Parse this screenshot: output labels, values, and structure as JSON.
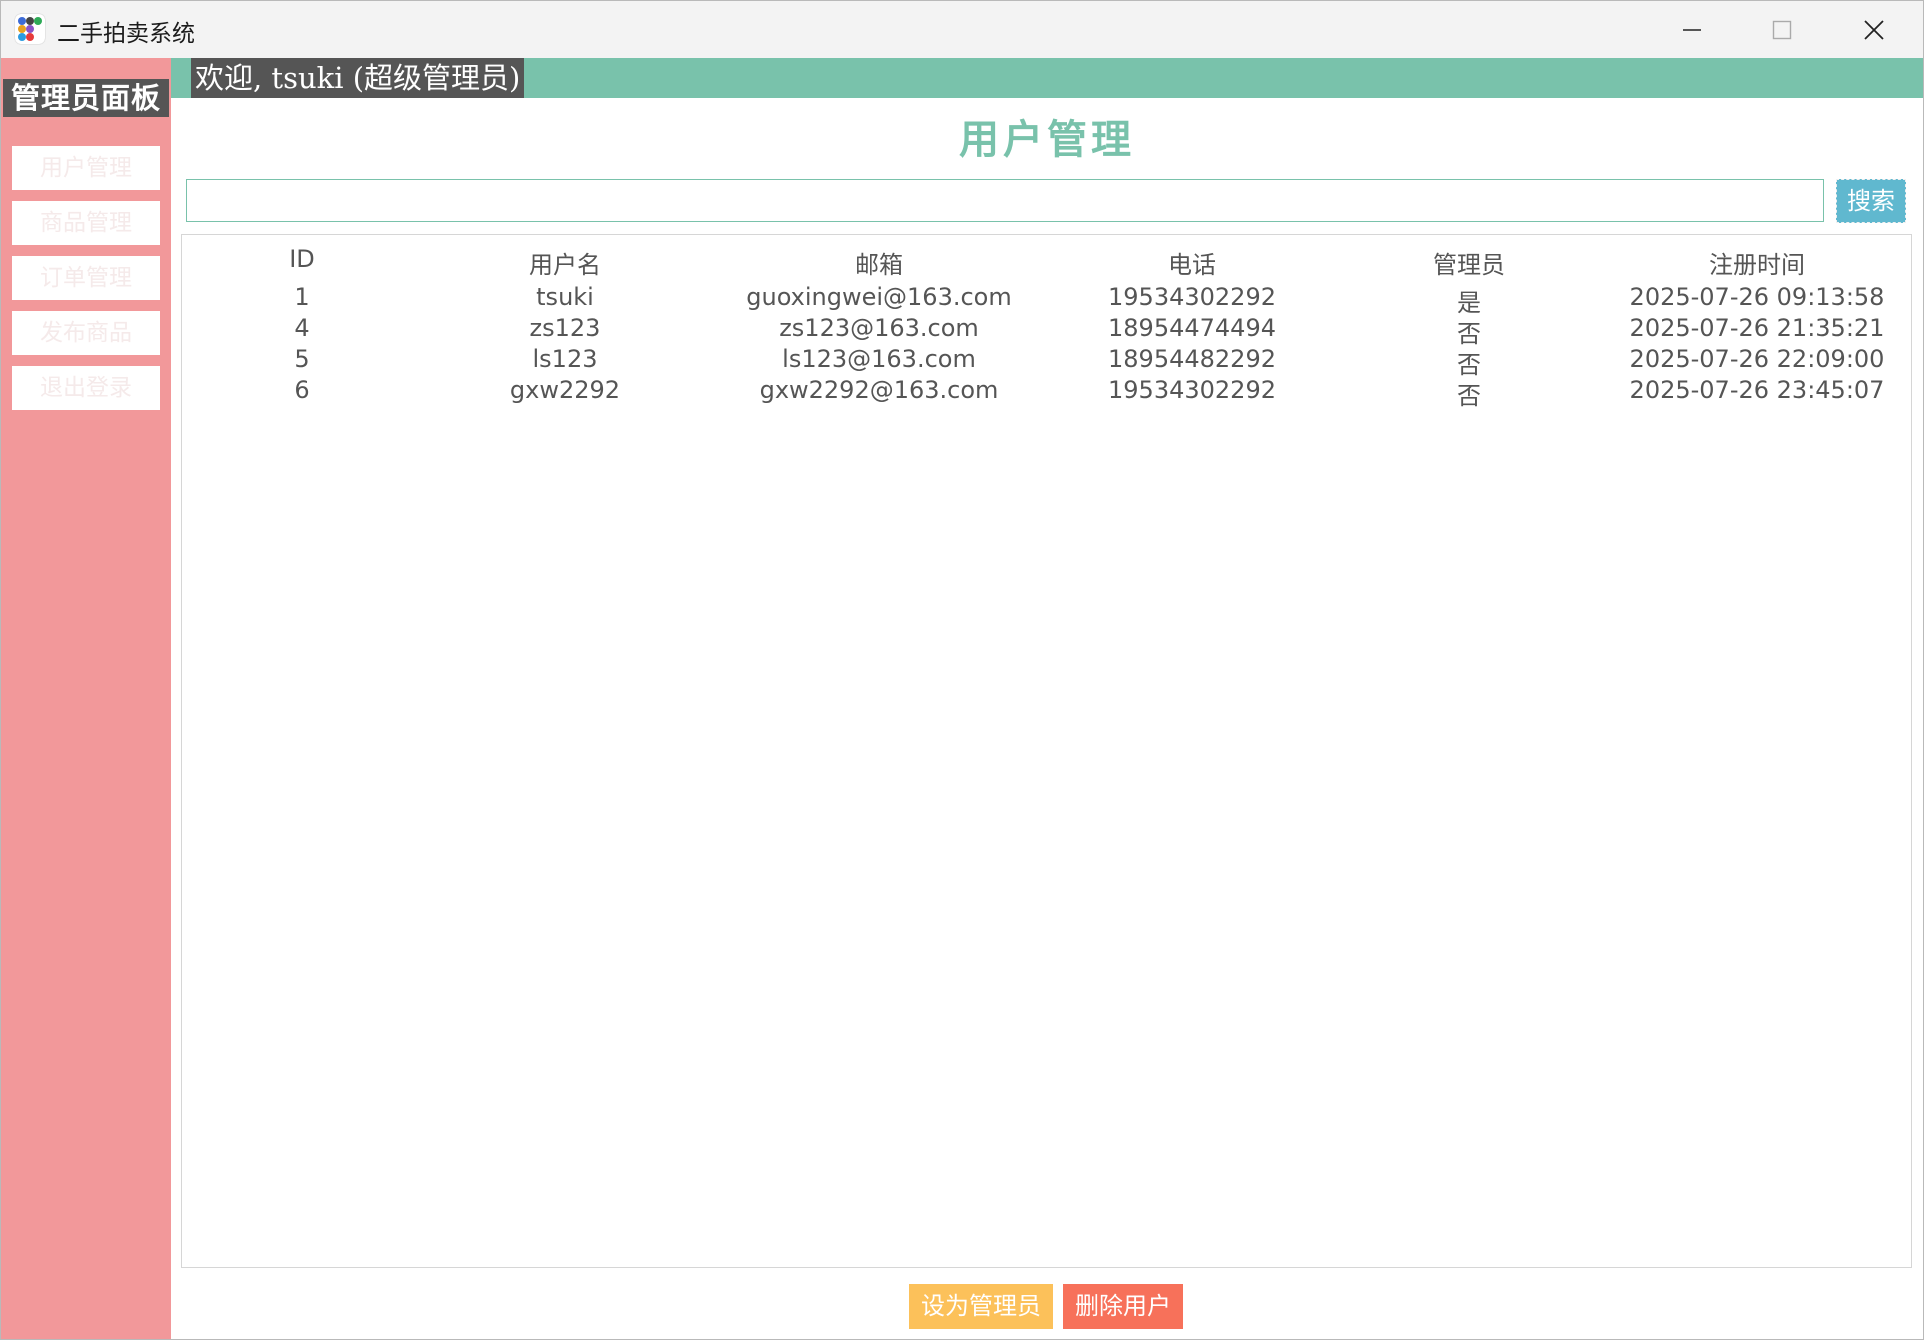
{
  "window": {
    "title": "二手拍卖系统"
  },
  "sidebar": {
    "title": "管理员面板",
    "items": [
      {
        "label": "用户管理"
      },
      {
        "label": "商品管理"
      },
      {
        "label": "订单管理"
      },
      {
        "label": "发布商品"
      },
      {
        "label": "退出登录"
      }
    ]
  },
  "header": {
    "welcome": "欢迎, tsuki (超级管理员)"
  },
  "main": {
    "title": "用户管理",
    "search": {
      "value": "",
      "button": "搜索"
    },
    "table": {
      "columns": [
        "ID",
        "用户名",
        "邮箱",
        "电话",
        "管理员",
        "注册时间"
      ],
      "rows": [
        [
          "1",
          "tsuki",
          "guoxingwei@163.com",
          "19534302292",
          "是",
          "2025-07-26 09:13:58"
        ],
        [
          "4",
          "zs123",
          "zs123@163.com",
          "18954474494",
          "否",
          "2025-07-26 21:35:21"
        ],
        [
          "5",
          "ls123",
          "ls123@163.com",
          "18954482292",
          "否",
          "2025-07-26 22:09:00"
        ],
        [
          "6",
          "gxw2292",
          "gxw2292@163.com",
          "19534302292",
          "否",
          "2025-07-26 23:45:07"
        ]
      ]
    },
    "actions": {
      "set_admin": "设为管理员",
      "delete_user": "删除用户"
    }
  },
  "colors": {
    "sidebar": "#f2989a",
    "accent": "#79c2ab",
    "search_button": "#60b8cf",
    "set_admin_button": "#fcc15a",
    "delete_button": "#f7715a"
  }
}
